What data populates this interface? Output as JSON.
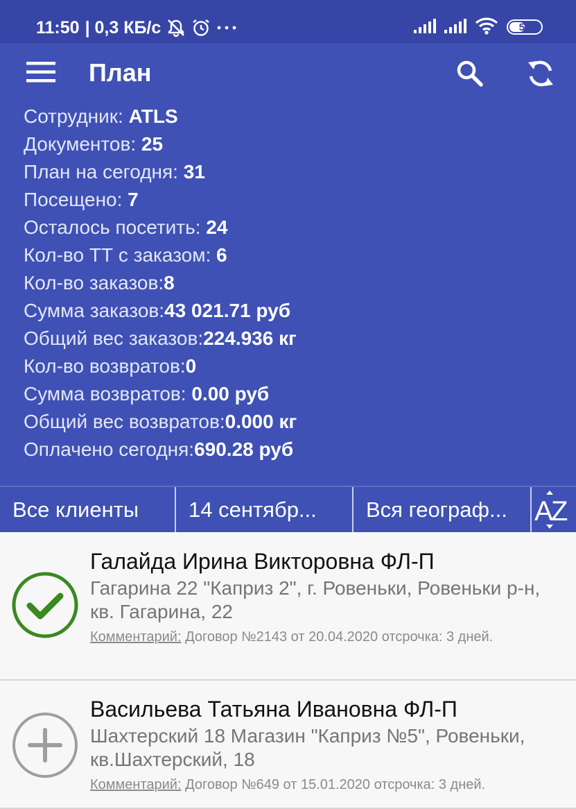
{
  "status_bar": {
    "time": "11:50",
    "network_speed": "| 0,3 КБ/с",
    "battery": "55",
    "battery_level": 0.55,
    "icons": [
      "notifications-off-icon",
      "alarm-icon",
      "more-notifications-icon",
      "signal-icon",
      "signal-icon",
      "wifi-icon",
      "battery-icon"
    ]
  },
  "header": {
    "title": "План",
    "icons": [
      "menu-icon",
      "search-icon",
      "sync-icon"
    ]
  },
  "stats": [
    {
      "label": "Сотрудник: ",
      "value": "ATLS"
    },
    {
      "label": "Документов: ",
      "value": "25"
    },
    {
      "label": "План на сегодня: ",
      "value": "31"
    },
    {
      "label": "Посещено: ",
      "value": "7"
    },
    {
      "label": "Осталось посетить: ",
      "value": "24"
    },
    {
      "label": "Кол-во ТТ с заказом: ",
      "value": "6"
    },
    {
      "label": "Кол-во заказов:",
      "value": "8"
    },
    {
      "label": "Сумма заказов:",
      "value": "43 021.71 руб"
    },
    {
      "label": "Общий вес заказов:",
      "value": "224.936 кг"
    },
    {
      "label": "Кол-во возвратов:",
      "value": "0"
    },
    {
      "label": "Сумма возвратов: ",
      "value": "0.00 руб"
    },
    {
      "label": "Общий вес возвратов:",
      "value": "0.000 кг"
    },
    {
      "label": "Оплачено сегодня:",
      "value": "690.28 руб"
    }
  ],
  "filters": {
    "clients": "Все клиенты",
    "date": "14 сентябр...",
    "geography": "Вся географ...",
    "sort_icon": "sort-az-icon"
  },
  "clients": [
    {
      "name": "Галайда Ирина Викторовна ФЛ-П",
      "address": "Гагарина 22 \"Каприз 2\", г. Ровеньки, Ровеньки р-н, кв. Гагарина, 22",
      "comment_label": "Комментарий:",
      "comment": " Договор №2143 от 20.04.2020 отсрочка: 3 дней.",
      "status_icon": "check-circle-icon",
      "status_color": "#3a8a1e"
    },
    {
      "name": "Васильева Татьяна Ивановна ФЛ-П",
      "address": "Шахтерский 18 Магазин \"Каприз №5\", Ровеньки, кв.Шахтерский, 18",
      "comment_label": "Комментарий:",
      "comment": " Договор №649 от 15.01.2020 отсрочка: 3 дней.",
      "status_icon": "add-circle-icon",
      "status_color": "#9e9e9e"
    }
  ],
  "colors": {
    "status_bar": "#3746a6",
    "app_bar": "#3f51b5",
    "list_background": "#f7f7f7"
  }
}
